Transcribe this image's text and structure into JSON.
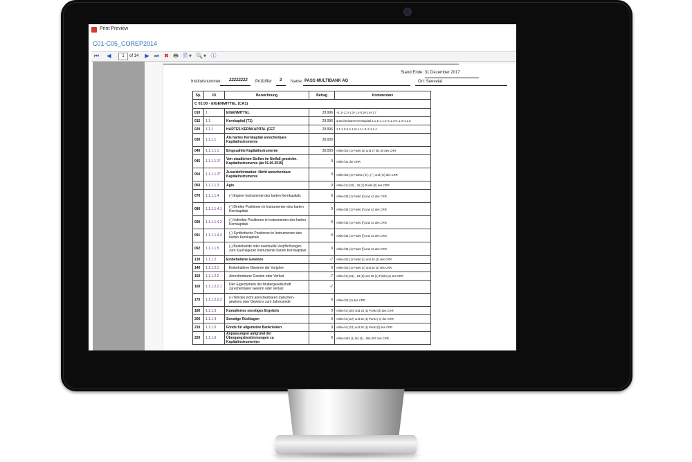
{
  "window": {
    "title": "Print Preview",
    "document_title": "C01-C05_COREP2014"
  },
  "toolbar": {
    "first_icon": "⏮",
    "prev_icon": "◀",
    "page_current": "1",
    "page_of": "of 14",
    "next_icon": "▶",
    "last_icon": "⏭",
    "close_icon": "✖",
    "print_icon": "🖶",
    "export_icon": "🗎",
    "zoom_icon": "🔍",
    "info_icon": "ⓘ",
    "dropdown_glyph": "▾"
  },
  "page": {
    "stand_ende": "Stand Ende: 31.Dezember 2017",
    "institutsnummer_label": "Institutsnummer:",
    "institutsnummer_value": "22222222",
    "pruefziffer_label": "Prüfziffer",
    "pruefziffer_value": "2",
    "name_label": "Name:",
    "name_value": "PASS MULTIBANK AG",
    "ort": "Ort: Seevetal"
  },
  "table": {
    "caption": "C 01.00 - EIGENMITTEL (CA1)",
    "headers": {
      "sp": "Sp.",
      "id": "ID",
      "bezeichnung": "Bezeichnung",
      "betrag": "Betrag",
      "kommentar": "Kommentare"
    },
    "rows": [
      {
        "sp": "010",
        "id": "1",
        "bez": "EIGENMITTEL",
        "bet": "29.996",
        "kom": "+1.1+1.2+1.3+1.4+1.5+1.6+1.7",
        "bold": true,
        "h": "r1"
      },
      {
        "sp": "015",
        "id": "1.1",
        "bez": "Kernkapital (T1)",
        "bet": "29.996",
        "kom": "anrechenbares Kernkapital 1.1.1+1.1.2+1.1.3+1.1.4+1.1.5",
        "bold": true,
        "h": "r1"
      },
      {
        "sp": "020",
        "id": "1.1.1",
        "bez": "HARTES KERNKAPITAL (CET",
        "bet": "29.996",
        "kom": "1.1.1.1+1.1.1.2+1.1.1.3+1.1.1.4",
        "bold": true,
        "h": "r1"
      },
      {
        "sp": "030",
        "id": "1.1.1.1",
        "bez": "Als hartes Kernkapital anrechenbare Kapitalinstrumente",
        "bet": "30.000",
        "kom": "",
        "bold": true,
        "h": "r2"
      },
      {
        "sp": "040",
        "id": "1.1.1.1.1",
        "bez": "Eingezahlte Kapitalinstrumente",
        "bet": "30.000",
        "kom": "Artikel 26 (1) Punkt (a) und 27 bis 30 des CRR",
        "bold": true,
        "h": "r1"
      },
      {
        "sp": "045",
        "id": "1.1.1.1.1*",
        "bez": "Von staatlichen Stellen im Notfall gezeichn. Kapitalinstrumente (ab 01.06.2015)",
        "bet": "0",
        "kom": "Artikel 31 der CRR",
        "bold": true,
        "h": "r2"
      },
      {
        "sp": "050",
        "id": "1.1.1.1.2*",
        "bez": "Zusatzinformation: Nicht anrechenbare Kapitalinstrumente",
        "bet": "0",
        "kom": "Artikel 28 (1) Punkte ( b ), ( l ) und (m) des CRR",
        "bold": true,
        "h": "r2"
      },
      {
        "sp": "060",
        "id": "1.1.1.1.3",
        "bez": "Agio",
        "bet": "0",
        "kom": "Artikel 4 (124) , 26 (1) Punkt (b) des CRR",
        "bold": true,
        "h": "r1"
      },
      {
        "sp": "070",
        "id": "1.1.1.1.4",
        "bez": "(-) Eigene Instrumente des harten Kernkapitals",
        "bet": "0",
        "kom": "Artikel 36 (1) Punkt (f) und 42 des CRR",
        "bold": false,
        "h": "r2"
      },
      {
        "sp": "080",
        "id": "1.1.1.1.4.1",
        "bez": "(-) Direkte Positionen in Instrumenten des harten Kernkapitals",
        "bet": "0",
        "kom": "Artikel 36 (1) Punkt (f) und 42 des CRR",
        "bold": false,
        "h": "r2"
      },
      {
        "sp": "090",
        "id": "1.1.1.1.4.2",
        "bez": "(-) Indirekte Positionen in Instrumenten des harten Kernkapitals",
        "bet": "0",
        "kom": "Artikel 36 (1) Punkt (f) und 42 des CRR",
        "bold": false,
        "h": "r2"
      },
      {
        "sp": "091",
        "id": "1.1.1.1.4.3",
        "bez": "(-) Synthetische Positionen in Instrumenten des harten Kernkapitals",
        "bet": "0",
        "kom": "Artikel 36 (1) Punkt (f) und 42 des CRR",
        "bold": false,
        "h": "r2"
      },
      {
        "sp": "092",
        "id": "1.1.1.1.5",
        "bez": "(-) Bestehende oder eventuelle Verpflichtungen zum Kauf eigener Instrumente harten Kernkapitals",
        "bet": "0",
        "kom": "Artikel 36 (1) Punkt (f) und 42 des CRR",
        "bold": false,
        "h": "r2"
      },
      {
        "sp": "130",
        "id": "1.1.1.2",
        "bez": "Einbehaltene Gewinne",
        "bet": "-7",
        "kom": "Artikel 26 (1) Punkt (c) und 26 (2) des CRR",
        "bold": true,
        "h": "r1"
      },
      {
        "sp": "140",
        "id": "1.1.1.2.1",
        "bez": "Einbehaltene Gewinne der Vorjahre",
        "bet": "0",
        "kom": "Artikel 26 (1) Punkt (c) und 26 (2) des CRR",
        "bold": false,
        "h": "r1"
      },
      {
        "sp": "150",
        "id": "1.1.1.2.2",
        "bez": "Anrechenbarer Gewinn oder Verlust",
        "bet": "-7",
        "kom": "Artikel 4 (121) , 26 (2) und 36 (1) Punkt (a) des CRR",
        "bold": false,
        "h": "r1"
      },
      {
        "sp": "160",
        "id": "1.1.1.2.2.1",
        "bez": "Den Eigentümern der Muttergesellschaft zurechenbarer Gewinn oder Verlust",
        "bet": "-7",
        "kom": "",
        "bold": false,
        "h": "r2"
      },
      {
        "sp": "170",
        "id": "1.1.1.2.2.2",
        "bez": "(-) Teil des nicht anrechenbaren Zwischen- gewinns oder Gewinns zum Jahresende",
        "bet": "0",
        "kom": "Artikel 26 (2) des CRR",
        "bold": false,
        "h": "r2"
      },
      {
        "sp": "180",
        "id": "1.1.1.3",
        "bez": "Kumuliertes sonstiges Ergebnis",
        "bet": "0",
        "kom": "Artikel 4 (100) und 26 (1) Punkt (d) des CRR",
        "bold": true,
        "h": "r1"
      },
      {
        "sp": "200",
        "id": "1.1.1.4",
        "bez": "Sonstige Rücklagen",
        "bet": "0",
        "kom": "Artikel 4 (117) und 26 (1) Punkt ( e) der CRR",
        "bold": true,
        "h": "r1"
      },
      {
        "sp": "210",
        "id": "1.1.1.5",
        "bez": "Fonds für allgemeine Bankrisiken",
        "bet": "0",
        "kom": "Artikel 4 (112) und 26 (1) Punkt (f) des CRR",
        "bold": true,
        "h": "r1"
      },
      {
        "sp": "220",
        "id": "1.1.1.6",
        "bez": "Anpassungen aufgrund der Übergangsbestimmungen zu Kapitalinstrumenten",
        "bet": "0",
        "kom": "Artikel 483 (1) bis (3) , 484-487 von CRR",
        "bold": true,
        "h": "r2"
      }
    ]
  }
}
